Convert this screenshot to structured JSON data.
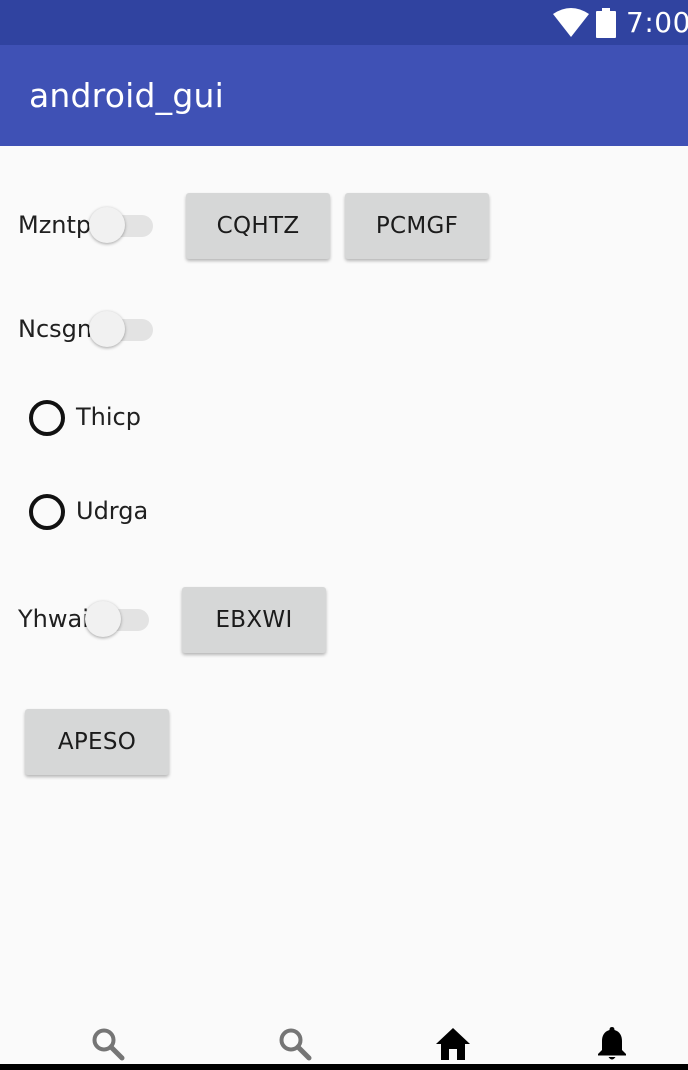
{
  "status_bar": {
    "time": "7:00",
    "icons": [
      "wifi-icon",
      "battery-icon"
    ],
    "color": "#3043a0"
  },
  "app_bar": {
    "title": "android_gui",
    "color": "#3f51b5"
  },
  "rows": {
    "mzntp": {
      "label": "Mzntp",
      "switch_on": false,
      "buttons": [
        "CQHTZ",
        "PCMGF"
      ]
    },
    "ncsgn": {
      "label": "Ncsgn",
      "switch_on": false
    },
    "thicp": {
      "label": "Thicp",
      "checked": false
    },
    "udrga": {
      "label": "Udrga",
      "checked": false
    },
    "yhwai": {
      "label": "Yhwai",
      "switch_on": false,
      "buttons": [
        "EBXWI"
      ]
    },
    "apeso": {
      "buttons": [
        "APESO"
      ]
    }
  },
  "bottom_nav": {
    "items": [
      {
        "icon": "search-icon"
      },
      {
        "icon": "search-icon"
      },
      {
        "icon": "home-icon"
      },
      {
        "icon": "bell-icon"
      }
    ]
  },
  "colors": {
    "background": "#fafafa",
    "button": "#d6d7d7",
    "switch_track": "#e3e3e3",
    "switch_thumb": "#f1f1f1"
  }
}
